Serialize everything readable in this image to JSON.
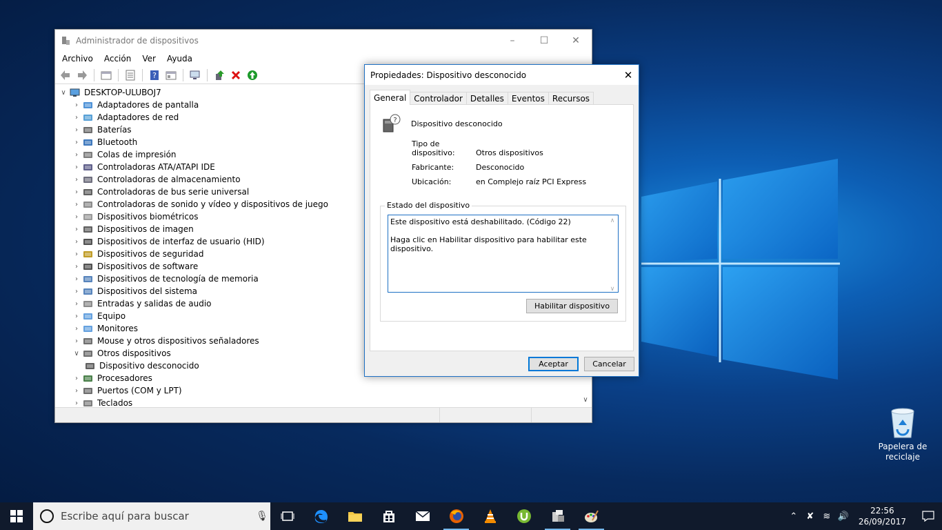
{
  "desktop": {
    "recycle_bin_label": "Papelera de reciclaje"
  },
  "device_manager": {
    "title": "Administrador de dispositivos",
    "menu": [
      "Archivo",
      "Acción",
      "Ver",
      "Ayuda"
    ],
    "root": "DESKTOP-ULUBOJ7",
    "categories": [
      {
        "label": "Adaptadores de pantalla",
        "icon": "display-adapter-icon"
      },
      {
        "label": "Adaptadores de red",
        "icon": "network-adapter-icon"
      },
      {
        "label": "Baterías",
        "icon": "battery-icon"
      },
      {
        "label": "Bluetooth",
        "icon": "bluetooth-icon"
      },
      {
        "label": "Colas de impresión",
        "icon": "printer-icon"
      },
      {
        "label": "Controladoras ATA/ATAPI IDE",
        "icon": "ide-controller-icon"
      },
      {
        "label": "Controladoras de almacenamiento",
        "icon": "storage-controller-icon"
      },
      {
        "label": "Controladoras de bus serie universal",
        "icon": "usb-icon"
      },
      {
        "label": "Controladoras de sonido y vídeo y dispositivos de juego",
        "icon": "sound-icon"
      },
      {
        "label": "Dispositivos biométricos",
        "icon": "fingerprint-icon"
      },
      {
        "label": "Dispositivos de imagen",
        "icon": "camera-icon"
      },
      {
        "label": "Dispositivos de interfaz de usuario (HID)",
        "icon": "hid-icon"
      },
      {
        "label": "Dispositivos de seguridad",
        "icon": "security-key-icon"
      },
      {
        "label": "Dispositivos de software",
        "icon": "software-device-icon"
      },
      {
        "label": "Dispositivos de tecnología de memoria",
        "icon": "memory-icon"
      },
      {
        "label": "Dispositivos del sistema",
        "icon": "system-device-icon"
      },
      {
        "label": "Entradas y salidas de audio",
        "icon": "speaker-icon"
      },
      {
        "label": "Equipo",
        "icon": "computer-icon"
      },
      {
        "label": "Monitores",
        "icon": "monitor-icon"
      },
      {
        "label": "Mouse y otros dispositivos señaladores",
        "icon": "mouse-icon"
      },
      {
        "label": "Otros dispositivos",
        "icon": "unknown-device-icon"
      },
      {
        "label": "Dispositivo desconocido",
        "icon": "disabled-device-icon"
      },
      {
        "label": "Procesadores",
        "icon": "processor-icon"
      },
      {
        "label": "Puertos (COM y LPT)",
        "icon": "port-icon"
      },
      {
        "label": "Teclados",
        "icon": "keyboard-icon"
      }
    ]
  },
  "properties": {
    "title": "Propiedades: Dispositivo desconocido",
    "tabs": [
      "General",
      "Controlador",
      "Detalles",
      "Eventos",
      "Recursos"
    ],
    "device_name": "Dispositivo desconocido",
    "type_label": "Tipo de dispositivo:",
    "type_value": "Otros dispositivos",
    "manufacturer_label": "Fabricante:",
    "manufacturer_value": "Desconocido",
    "location_label": "Ubicación:",
    "location_value": "en Complejo raíz PCI Express",
    "status_group_label": "Estado del dispositivo",
    "status_line1": "Este dispositivo está deshabilitado. (Código 22)",
    "status_line2": "Haga clic en Habilitar dispositivo para habilitar este dispositivo.",
    "enable_button": "Habilitar dispositivo",
    "ok_button": "Aceptar",
    "cancel_button": "Cancelar"
  },
  "taskbar": {
    "search_placeholder": "Escribe aquí para buscar",
    "time": "22:56",
    "date": "26/09/2017"
  }
}
